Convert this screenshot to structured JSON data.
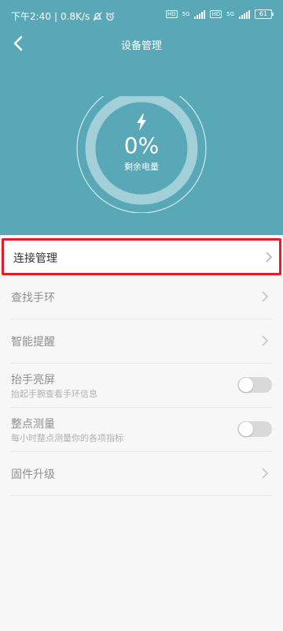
{
  "colors": {
    "header_bg": "#58a8b8",
    "highlight_border": "#e31d2a"
  },
  "status": {
    "time": "下午2:40",
    "speed": "0.8K/s",
    "icons": [
      "mute-bell-icon",
      "alarm-icon",
      "hd-icon",
      "signal-5g-icon",
      "hd-icon",
      "signal-5g-icon"
    ],
    "net_label_1": "5G",
    "net_label_2": "5G",
    "hd_label": "HD",
    "battery": "61"
  },
  "header": {
    "title": "设备管理",
    "back_icon": "chevron-left-icon"
  },
  "battery_gauge": {
    "icon": "lightning-icon",
    "percent": "0%",
    "label": "剩余电量",
    "level": 0
  },
  "menu": {
    "connection": {
      "label": "连接管理"
    },
    "find_band": {
      "label": "查找手环"
    },
    "smart_reminder": {
      "label": "智能提醒"
    },
    "raise_wake": {
      "label": "抬手亮屏",
      "sub": "抬起手腕查看手环信息",
      "enabled": false
    },
    "hourly_measure": {
      "label": "整点测量",
      "sub": "每小时整点测量你的各项指标",
      "enabled": false
    },
    "firmware": {
      "label": "固件升级"
    }
  }
}
